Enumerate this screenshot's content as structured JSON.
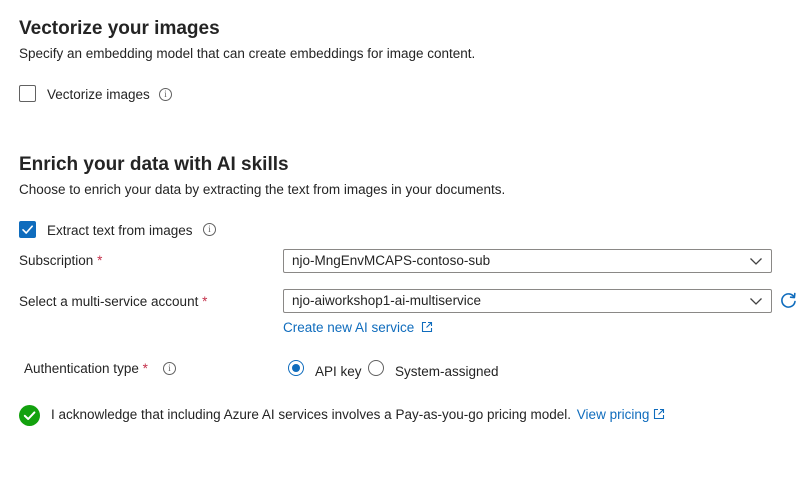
{
  "vectorize": {
    "title": "Vectorize your images",
    "description": "Specify an embedding model that can create embeddings for image content.",
    "checkbox_label": "Vectorize images",
    "checked": false
  },
  "enrich": {
    "title": "Enrich your data with AI skills",
    "description": "Choose to enrich your data by extracting the text from images in your documents.",
    "extract_label": "Extract text from images",
    "extract_checked": true
  },
  "form": {
    "subscription_label": "Subscription",
    "subscription_value": "njo-MngEnvMCAPS-contoso-sub",
    "account_label": "Select a multi-service account",
    "account_value": "njo-aiworkshop1-ai-multiservice",
    "create_link": "Create new AI service",
    "auth_label": "Authentication type",
    "auth_options": [
      "API key",
      "System-assigned"
    ],
    "auth_selected": "API key",
    "required_marker": "*",
    "info_glyph": "i"
  },
  "ack": {
    "text": "I acknowledge that including Azure AI services involves a Pay-as-you-go pricing model.",
    "link": "View pricing"
  },
  "colors": {
    "accent": "#0f6cbd",
    "success": "#13a10e",
    "required": "#c4314b"
  }
}
